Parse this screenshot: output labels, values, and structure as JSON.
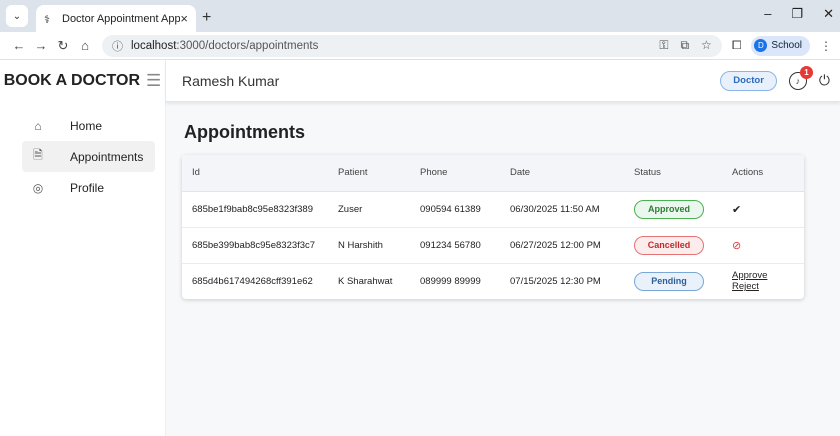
{
  "browser": {
    "tab_title": "Doctor Appointment App",
    "url_host": "localhost",
    "url_rest": ":3000/doctors/appointments",
    "profile_label": "School",
    "profile_initial": "D"
  },
  "sidebar": {
    "brand": "BOOK A DOCTOR",
    "items": [
      {
        "label": "Home",
        "icon": "home-icon"
      },
      {
        "label": "Appointments",
        "icon": "document-icon"
      },
      {
        "label": "Profile",
        "icon": "user-circle-icon"
      }
    ]
  },
  "topbar": {
    "user_name": "Ramesh Kumar",
    "role": "Doctor",
    "notification_count": "1"
  },
  "page": {
    "title": "Appointments"
  },
  "table": {
    "headers": [
      "Id",
      "Patient",
      "Phone",
      "Date",
      "Status",
      "Actions"
    ],
    "rows": [
      {
        "id": "685be1f9bab8c95e8323f389",
        "patient": "Zuser",
        "phone": "090594 61389",
        "date": "06/30/2025 11:50 AM",
        "status": "Approved",
        "action": "✔"
      },
      {
        "id": "685be399bab8c95e8323f3c7",
        "patient": "N Harshith",
        "phone": "091234 56780",
        "date": "06/27/2025 12:00 PM",
        "status": "Cancelled",
        "action": "⊘"
      },
      {
        "id": "685d4b617494268cff391e62",
        "patient": "K Sharahwat",
        "phone": "089999 89999",
        "date": "07/15/2025 12:30 PM",
        "status": "Pending",
        "approve": "Approve",
        "reject": "Reject"
      }
    ]
  },
  "colors": {
    "approved": "#2e7d32",
    "cancelled": "#c62828",
    "pending": "#2c5f9a",
    "notification": "#e53935"
  }
}
